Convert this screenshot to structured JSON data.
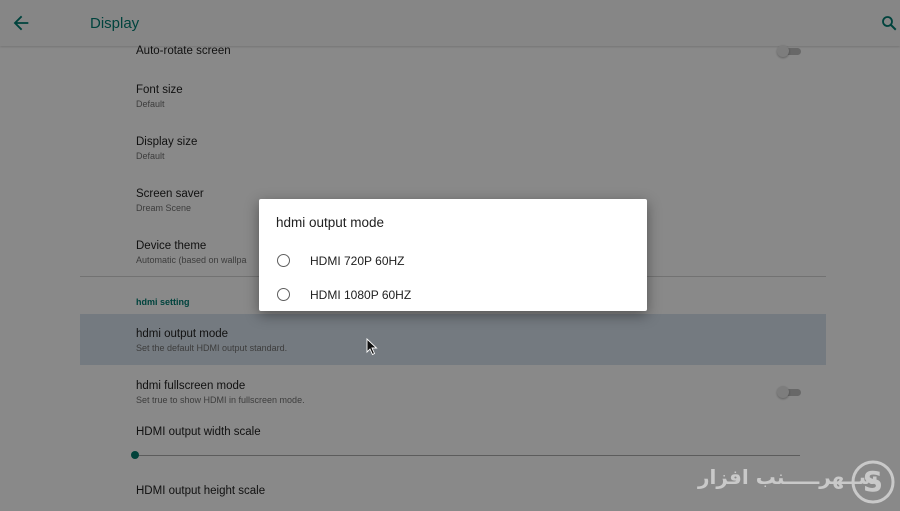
{
  "header": {
    "title": "Display",
    "back_icon": "arrow-back-icon",
    "search_icon": "search-icon",
    "accent_color": "#007a70"
  },
  "settings": {
    "auto_rotate": {
      "title": "Auto-rotate screen",
      "enabled": false
    },
    "font_size": {
      "title": "Font size",
      "summary": "Default"
    },
    "display_size": {
      "title": "Display size",
      "summary": "Default"
    },
    "screen_saver": {
      "title": "Screen saver",
      "summary": "Dream Scene"
    },
    "device_theme": {
      "title": "Device theme",
      "summary": "Automatic (based on wallpa"
    },
    "hdmi_section": {
      "header": "hdmi setting"
    },
    "hdmi_output_mode": {
      "title": "hdmi output mode",
      "summary": "Set the default HDMI output standard."
    },
    "hdmi_fullscreen": {
      "title": "hdmi fullscreen mode",
      "summary": "Set true to show HDMI in fullscreen mode.",
      "enabled": false
    },
    "hdmi_width_scale": {
      "title": "HDMI output width scale",
      "value": 0
    },
    "hdmi_height_scale": {
      "title": "HDMI output height scale"
    }
  },
  "dialog": {
    "title": "hdmi output mode",
    "options": [
      {
        "label": "HDMI 720P 60HZ",
        "selected": false
      },
      {
        "label": "HDMI 1080P 60HZ",
        "selected": false
      }
    ]
  },
  "watermark": {
    "text": "ســهرـــــنب افزار",
    "logo_icon": "s-logo-icon"
  }
}
